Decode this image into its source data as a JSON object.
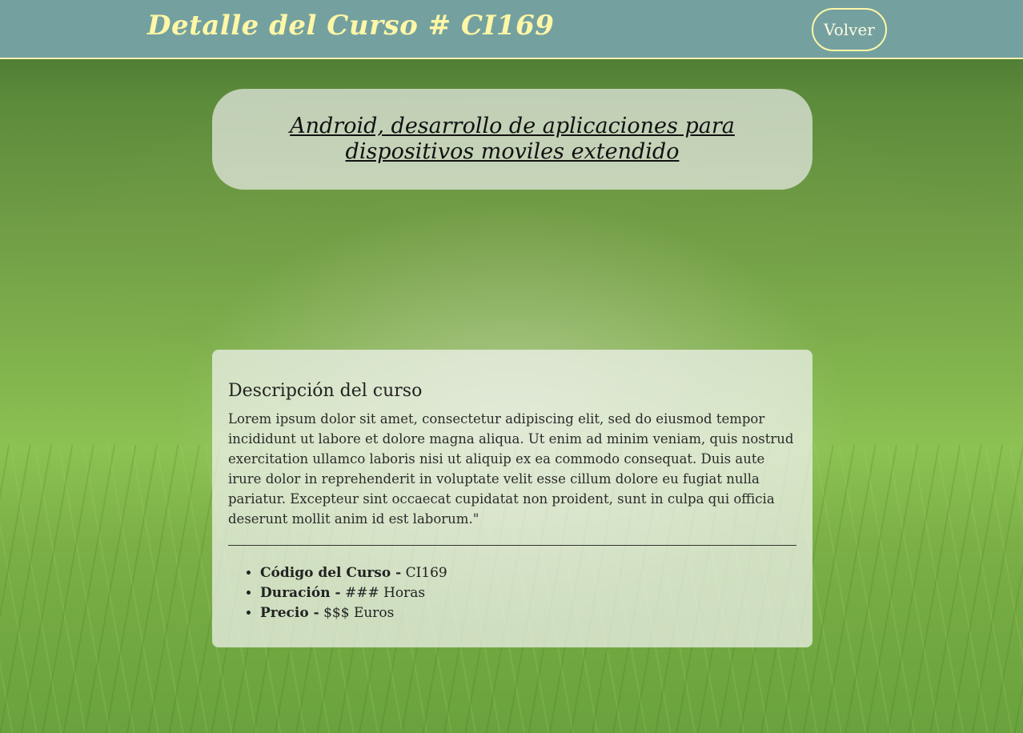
{
  "header": {
    "title": "Detalle del Curso # CI169",
    "back_label": "Volver"
  },
  "course": {
    "title": "Android, desarrollo de aplicaciones para dispositivos moviles extendido"
  },
  "description": {
    "heading": "Descripción del curso",
    "text": "Lorem ipsum dolor sit amet, consectetur adipiscing elit, sed do eiusmod tempor incididunt ut labore et dolore magna aliqua. Ut enim ad minim veniam, quis nostrud exercitation ullamco laboris nisi ut aliquip ex ea commodo consequat. Duis aute irure dolor in reprehenderit in voluptate velit esse cillum dolore eu fugiat nulla pariatur. Excepteur sint occaecat cupidatat non proident, sunt in culpa qui officia deserunt mollit anim id est laborum.\""
  },
  "details": [
    {
      "label": "Código del Curso -",
      "value": " CI169"
    },
    {
      "label": "Duración -",
      "value": " ### Horas"
    },
    {
      "label": "Precio -",
      "value": " $$$ Euros"
    }
  ],
  "colors": {
    "header_bg": "#74a1a0",
    "header_text": "#fff7a6"
  }
}
